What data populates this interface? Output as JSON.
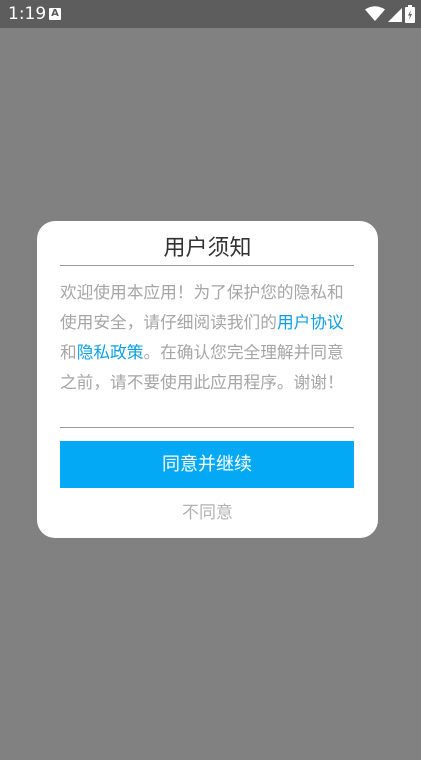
{
  "status_bar": {
    "time": "1:19",
    "notification_badge": "A",
    "icons": [
      "wifi-icon",
      "signal-icon",
      "battery-icon"
    ]
  },
  "dialog": {
    "title": "用户须知",
    "body": {
      "text_before": "欢迎使用本应用！为了保护您的隐私和使用安全，请仔细阅读我们的",
      "link_agreement": "用户协议",
      "text_and": "和",
      "link_privacy": "隐私政策",
      "text_after": "。在确认您完全理解并同意之前，请不要使用此应用程序。谢谢！"
    },
    "agree_label": "同意并继续",
    "disagree_label": "不同意"
  },
  "colors": {
    "backdrop": "#818181",
    "status_bar": "#5d5d5d",
    "accent": "#03a9f4",
    "link": "#0e9fe6",
    "body_text": "#a6a6a6"
  }
}
